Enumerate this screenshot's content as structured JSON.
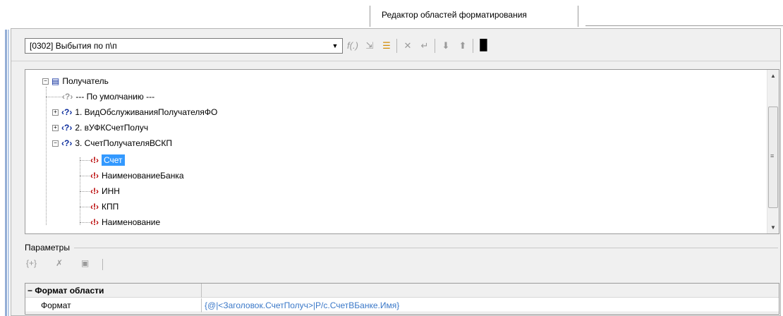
{
  "tab": {
    "title": "Редактор областей форматирования"
  },
  "toolbar": {
    "combo_value": "[0302] Выбытия по п\\п",
    "combo_arrow": "▼",
    "buttons": [
      {
        "name": "formula-icon",
        "glyph": "f(.)"
      },
      {
        "name": "pick-icon",
        "glyph": "⇲"
      },
      {
        "name": "list-icon",
        "glyph": "☰"
      },
      {
        "name": "delete-rows-icon",
        "glyph": "✕"
      },
      {
        "name": "insert-rows-icon",
        "glyph": "↵"
      },
      {
        "name": "move-down-icon",
        "glyph": "⬇"
      },
      {
        "name": "move-up-icon",
        "glyph": "⬆"
      },
      {
        "name": "save-icon",
        "glyph": "▉"
      }
    ]
  },
  "tree": {
    "root": {
      "label": "Получатель",
      "expand": "−"
    },
    "items": [
      {
        "label": "--- По умолчанию ---"
      },
      {
        "label": "1. ВидОбслуживанияПолучателяФО",
        "expand": "+"
      },
      {
        "label": "2. вУФКСчетПолуч",
        "expand": "+"
      },
      {
        "label": "3. СчетПолучателяВСКП",
        "expand": "−"
      }
    ],
    "children": [
      {
        "label": "Счет"
      },
      {
        "label": "НаименованиеБанка"
      },
      {
        "label": "ИНН"
      },
      {
        "label": "КПП"
      },
      {
        "label": "Наименование"
      }
    ],
    "icons": {
      "q": "‹?›",
      "f": "‹!›",
      "doc": "▤"
    },
    "scroll": {
      "up": "▲",
      "down": "▼",
      "grip": "≡"
    }
  },
  "params": {
    "title": "Параметры",
    "tools": [
      "{+}",
      "✗",
      "▣"
    ],
    "grid": {
      "category": "Формат области",
      "category_sign": "−",
      "row_label": "Формат",
      "row_value": "{@|<Заголовок.СчетПолуч>|Р/с.СчетВБанке.Имя}"
    }
  }
}
